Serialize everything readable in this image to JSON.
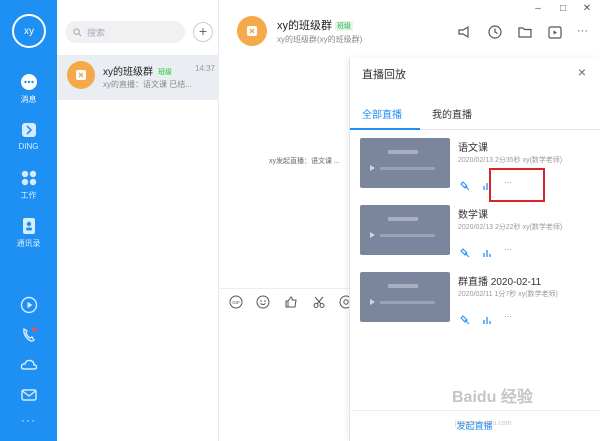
{
  "profile": {
    "avatar_text": "xy"
  },
  "rail": {
    "items": [
      {
        "label": "消息",
        "icon": "chat-bubble-icon"
      },
      {
        "label": "DING",
        "icon": "ding-icon"
      },
      {
        "label": "工作",
        "icon": "grid-icon"
      },
      {
        "label": "通讯录",
        "icon": "contacts-icon"
      }
    ],
    "bottom_icons": [
      "play-circle-icon",
      "phone-icon",
      "cloud-icon",
      "mail-icon",
      "more-dots-icon"
    ],
    "bottom_more": "···"
  },
  "search": {
    "placeholder": "搜索"
  },
  "add_button": "+",
  "conversation": {
    "name": "xy的班级群",
    "badge": "班级",
    "time": "14:37",
    "preview": "xy的直播：语文课 已结..."
  },
  "chat_header": {
    "title": "xy的班级群",
    "badge": "班级",
    "subtitle": "xy的班级群(xy的班级群)",
    "more": "···"
  },
  "window_controls": {
    "minimize": "–",
    "maximize": "□",
    "close": "✕"
  },
  "messages": [
    "xy发起直播：语文课 ..."
  ],
  "panel": {
    "title": "直播回放",
    "close": "×",
    "tabs": [
      "全部直播",
      "我的直播"
    ],
    "active_tab": 0,
    "items": [
      {
        "name": "语文课",
        "meta": "2020/02/13 2分35秒 xy(数学老师)"
      },
      {
        "name": "数学课",
        "meta": "2020/02/13 2分22秒 xy(数学老师)"
      },
      {
        "name": "群直播 2020-02-11",
        "meta": "2020/02/11 1分7秒 xy(数学老师)"
      }
    ],
    "more_label": "···",
    "go_live": "发起直播"
  },
  "watermark": {
    "main": "Baidu 经验",
    "sub": "jingyan.baidu.com"
  },
  "colors": {
    "accent": "#1e8ff3",
    "highlight": "#d9252a",
    "group_avatar": "#f5a94a"
  }
}
